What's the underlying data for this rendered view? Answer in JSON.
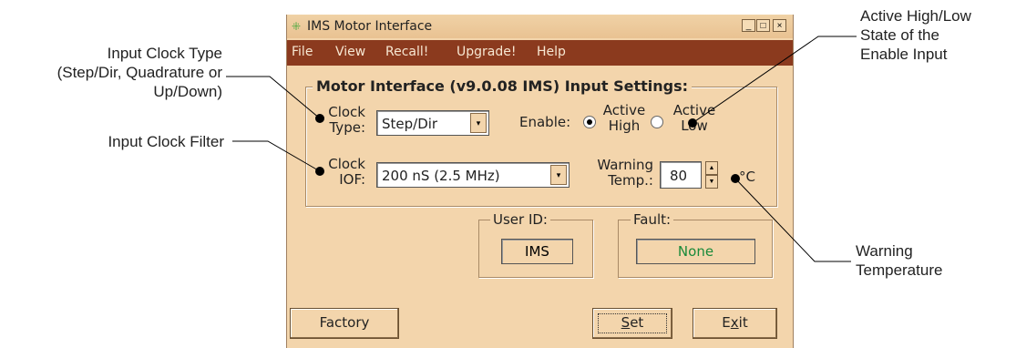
{
  "window": {
    "title": "IMS Motor Interface",
    "controls": {
      "minimize": "_",
      "maximize": "□",
      "close": "×"
    }
  },
  "menu": [
    "File",
    "View",
    "Recall!",
    "Upgrade!",
    "Help"
  ],
  "settings": {
    "group_title": "Motor Interface (v9.0.08 IMS) Input Settings:",
    "clock_type": {
      "label_line1": "Clock",
      "label_line2": "Type:",
      "value": "Step/Dir"
    },
    "clock_iof": {
      "label_line1": "Clock",
      "label_line2": "IOF:",
      "value": "200 nS (2.5 MHz)"
    },
    "enable": {
      "label": "Enable:",
      "options": [
        {
          "line1": "Active",
          "line2": "High",
          "checked": true
        },
        {
          "line1": "Active",
          "line2": "Low",
          "checked": false
        }
      ]
    },
    "warning_temp": {
      "label_line1": "Warning",
      "label_line2": "Temp.:",
      "value": "80",
      "unit": "°C"
    }
  },
  "user_id": {
    "title": "User ID:",
    "value": "IMS"
  },
  "fault": {
    "title": "Fault:",
    "value": "None",
    "value_color": "#1a8a3a"
  },
  "buttons": {
    "factory": "Factory",
    "set_u": "S",
    "set_rest": "et",
    "exit_pre": "E",
    "exit_u": "x",
    "exit_rest": "it"
  },
  "callouts": {
    "clock_type": [
      "Input Clock Type",
      "(Step/Dir, Quadrature or",
      "Up/Down)"
    ],
    "clock_filter": [
      "Input Clock Filter"
    ],
    "enable_state": [
      "Active High/Low",
      "State of the",
      "Enable Input"
    ],
    "warning_temp": [
      "Warning",
      "Temperature"
    ]
  },
  "colors": {
    "window_bg": "#f3d5ac",
    "menubar_bg": "#8b3a1e",
    "menubar_text": "#f7e7d2"
  }
}
